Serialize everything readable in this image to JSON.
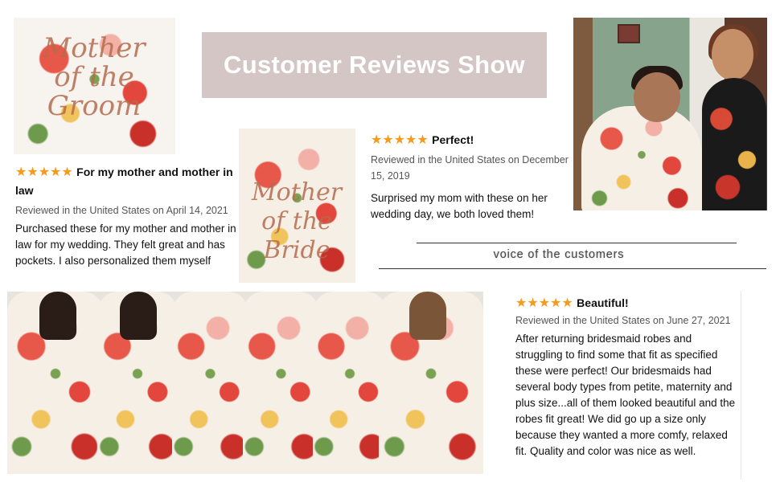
{
  "banner": {
    "title": "Customer Reviews Show"
  },
  "voice": {
    "label": "voice of the customers"
  },
  "photos": {
    "robe1_lettering": "Mother of the Groom",
    "robe2_lettering": "Mother of the Bride"
  },
  "reviews": [
    {
      "stars": "★★★★★",
      "title": "For my mother and mother in law",
      "meta": "Reviewed in the United States on April 14, 2021",
      "body": "Purchased these for my mother and mother in law for my wedding. They felt great and has pockets. I also personalized them myself"
    },
    {
      "stars": "★★★★★",
      "title": "Perfect!",
      "meta": "Reviewed in the United States on December 15, 2019",
      "body": "Surprised my mom with these on her wedding day, we both loved them!"
    },
    {
      "stars": "★★★★★",
      "title": "Beautiful!",
      "meta": "Reviewed in the United States on June 27, 2021",
      "body": "After returning bridesmaid robes and struggling to find some that fit as specified these were perfect! Our bridesmaids had several body types from petite, maternity and plus size...all of them looked beautiful and the robes fit great! We did go up a size only because they wanted a more comfy, relaxed fit. Quality and color was nice as well."
    }
  ],
  "colors": {
    "banner_bg": "#d3c6c4",
    "star": "#f49b1e"
  },
  "icons": {
    "star": "star-icon"
  }
}
